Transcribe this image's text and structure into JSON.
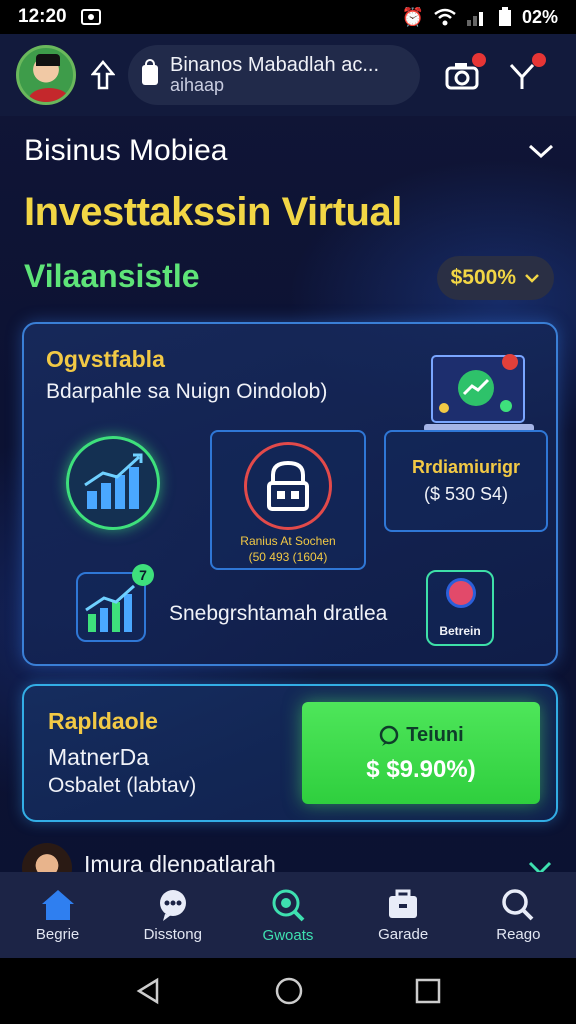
{
  "status_bar": {
    "time": "12:20",
    "battery": "02%"
  },
  "top_bar": {
    "search_title": "Binanos Mabadlah ac...",
    "search_subtitle": "aihaap"
  },
  "section": {
    "title": "Bisinus Mobiea"
  },
  "headline": "Investtakssin Virtual",
  "subheadline": "Vilaansistle",
  "percent_chip": "$500%",
  "card1": {
    "title": "Ogvstfabla",
    "description": "Bdarpahle sa Nuign Oindolob)",
    "mid_line1": "Ranius At Sochen",
    "mid_line2": "(50 493 (1604)",
    "right_title": "Rrdiamiurigr",
    "right_value": "($ 530 S4)",
    "growth_badge": "7",
    "growth_label": "Snebgrshtamah dratlea",
    "search_tile_label": "Betrein"
  },
  "card2": {
    "title": "Rapldaole",
    "line1": "MatnerDa",
    "line2": "Osbalet (labtav)",
    "button_top": "Teiuni",
    "button_price": "$ $9.90%)"
  },
  "row3": {
    "text": "Imura dlenpatlarah"
  },
  "bottom_nav": [
    {
      "label": "Begrie",
      "icon": "home-icon"
    },
    {
      "label": "Disstong",
      "icon": "chat-icon"
    },
    {
      "label": "Gwoats",
      "icon": "search-globe-icon"
    },
    {
      "label": "Garade",
      "icon": "briefcase-icon"
    },
    {
      "label": "Reago",
      "icon": "search-icon"
    }
  ],
  "colors": {
    "accent_yellow": "#f2d645",
    "accent_green": "#5ee478",
    "button_green": "#3ad84a",
    "card_border": "#3a7fd6"
  }
}
